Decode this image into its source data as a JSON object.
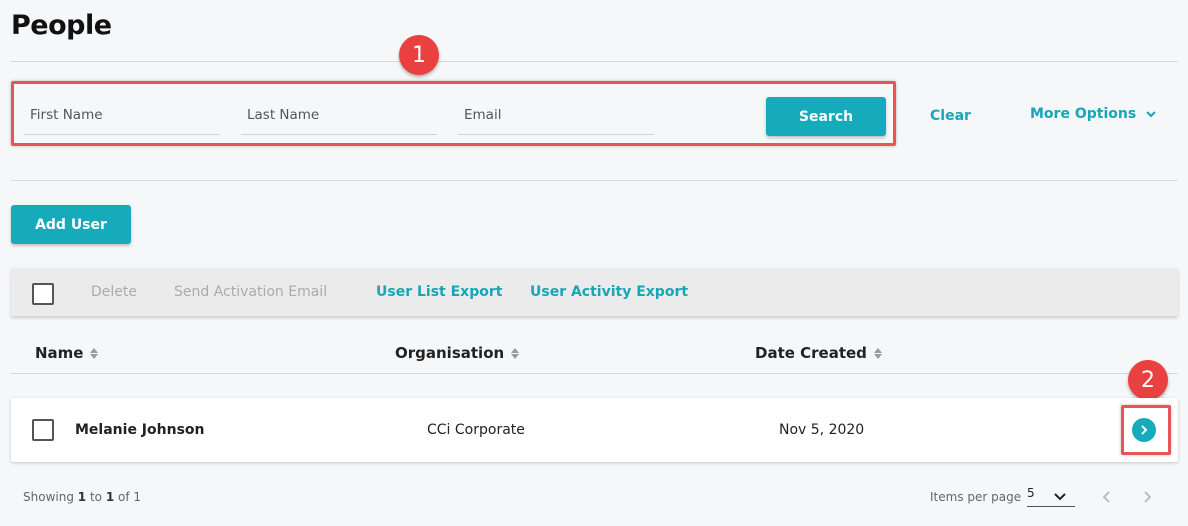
{
  "page": {
    "title": "People"
  },
  "annotations": [
    "1",
    "2"
  ],
  "search": {
    "first_name_placeholder": "First Name",
    "last_name_placeholder": "Last Name",
    "email_placeholder": "Email",
    "search_label": "Search",
    "clear_label": "Clear",
    "more_options_label": "More Options"
  },
  "actions": {
    "add_user_label": "Add User"
  },
  "toolbar": {
    "delete_label": "Delete",
    "send_activation_label": "Send Activation Email",
    "user_list_export_label": "User List Export",
    "user_activity_export_label": "User Activity Export"
  },
  "table": {
    "columns": [
      "Name",
      "Organisation",
      "Date Created"
    ],
    "rows": [
      {
        "name": "Melanie Johnson",
        "organisation": "CCi Corporate",
        "date_created": "Nov 5, 2020"
      }
    ]
  },
  "footer": {
    "showing_prefix": "Showing",
    "range_start": "1",
    "to_word": "to",
    "range_end": "1",
    "of_word": "of 1",
    "items_per_page_label": "Items per page",
    "items_per_page_value": "5"
  },
  "colors": {
    "accent": "#16abbb",
    "annotation": "#e8413f"
  },
  "icons": [
    "chevron-down-icon",
    "chevron-right-icon",
    "chevron-left-icon",
    "sort-icon"
  ]
}
